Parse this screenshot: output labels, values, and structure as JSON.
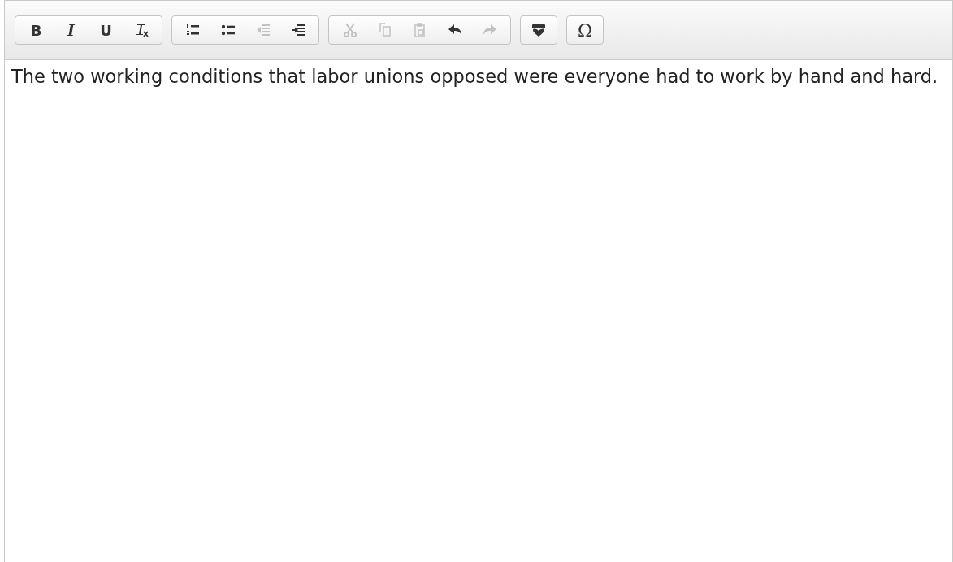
{
  "toolbar": {
    "groups": [
      {
        "buttons": [
          {
            "kind": "bold",
            "label": "B",
            "disabled": false
          },
          {
            "kind": "italic",
            "label": "I",
            "disabled": false
          },
          {
            "kind": "underline",
            "label": "U",
            "disabled": false
          },
          {
            "kind": "remove-format",
            "disabled": false
          }
        ]
      },
      {
        "buttons": [
          {
            "kind": "numbered-list",
            "disabled": false
          },
          {
            "kind": "bulleted-list",
            "disabled": false
          },
          {
            "kind": "outdent",
            "disabled": true
          },
          {
            "kind": "indent",
            "disabled": false
          }
        ]
      },
      {
        "buttons": [
          {
            "kind": "cut",
            "disabled": true
          },
          {
            "kind": "copy",
            "disabled": true
          },
          {
            "kind": "paste",
            "disabled": true
          },
          {
            "kind": "undo",
            "disabled": false
          },
          {
            "kind": "redo",
            "disabled": true
          }
        ]
      },
      {
        "buttons": [
          {
            "kind": "spellcheck",
            "disabled": false
          }
        ]
      },
      {
        "buttons": [
          {
            "kind": "special-character",
            "label": "Ω",
            "disabled": false
          }
        ]
      }
    ]
  },
  "editor": {
    "text": "The two working conditions that labor unions opposed were everyone had to work by hand and hard.",
    "caret": true
  }
}
